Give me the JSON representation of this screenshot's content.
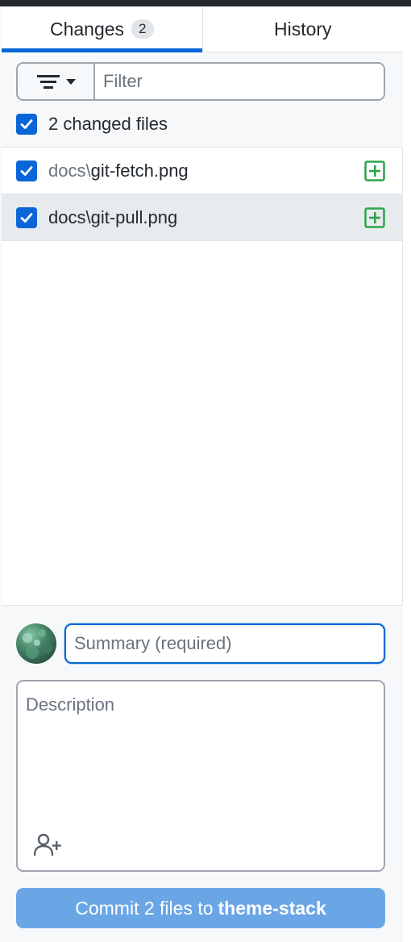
{
  "tabs": [
    {
      "label": "Changes",
      "badge": "2",
      "selected": true
    },
    {
      "label": "History",
      "selected": false
    }
  ],
  "filter": {
    "placeholder": "Filter",
    "icon": "filter-icon"
  },
  "select_all": {
    "label": "2 changed files",
    "checked": true
  },
  "files": [
    {
      "dir": "docs\\",
      "name": "git-fetch.png",
      "checked": true,
      "status": "added",
      "selected": false
    },
    {
      "dir": "docs\\",
      "name": "git-pull.png",
      "checked": true,
      "status": "added",
      "selected": true
    }
  ],
  "commit": {
    "summary_placeholder": "Summary (required)",
    "description_placeholder": "Description",
    "button_prefix": "Commit 2 files to",
    "button_branch": "theme-stack"
  },
  "colors": {
    "accent": "#0366d6",
    "checkbox": "#0a66d8",
    "added": "#2da44e",
    "commit_button": "#6aa6e6"
  }
}
